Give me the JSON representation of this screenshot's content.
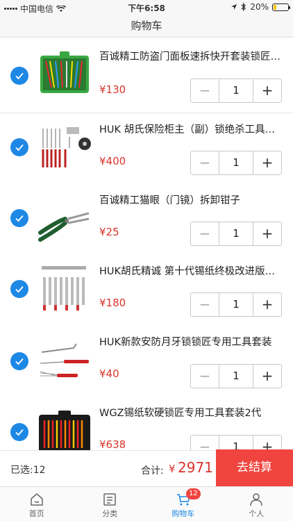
{
  "status_bar": {
    "carrier": "中国电信",
    "time": "下午6:58",
    "battery": "20%"
  },
  "header": {
    "title": "购物车"
  },
  "cart": {
    "items": [
      {
        "title": "百诚精工防盗门面板速拆快开套装锁匠工具",
        "price": "¥130",
        "quantity": "1",
        "checked": true
      },
      {
        "title": "HUK 胡氏保险柜主（副）锁绝杀工具套装",
        "price": "¥400",
        "quantity": "1",
        "checked": true
      },
      {
        "title": "百诚精工猫眼（门镜）拆卸钳子",
        "price": "¥25",
        "quantity": "1",
        "checked": true
      },
      {
        "title": "HUK胡氏精诚 第十代锡纸终极改进版工具",
        "price": "¥180",
        "quantity": "1",
        "checked": true
      },
      {
        "title": "HUK新款安防月牙锁锁匠专用工具套装",
        "price": "¥40",
        "quantity": "1",
        "checked": true
      },
      {
        "title": "WGZ锡纸软硬锁匠专用工具套装2代",
        "price": "¥638",
        "quantity": "1",
        "checked": true
      }
    ],
    "minus": "−",
    "plus": "+"
  },
  "summary": {
    "selected": "已选:12",
    "total_label": "合计:",
    "total_symbol": "¥",
    "total_value": "2971",
    "checkout": "去结算"
  },
  "tabbar": {
    "items": [
      {
        "label": "首页",
        "icon": "home-icon"
      },
      {
        "label": "分类",
        "icon": "category-icon"
      },
      {
        "label": "购物车",
        "icon": "cart-icon",
        "badge": "12",
        "active": true
      },
      {
        "label": "个人",
        "icon": "user-icon"
      }
    ]
  },
  "colors": {
    "accent": "#1e88e5",
    "price": "#d9342b",
    "checkout": "#f0443f"
  }
}
